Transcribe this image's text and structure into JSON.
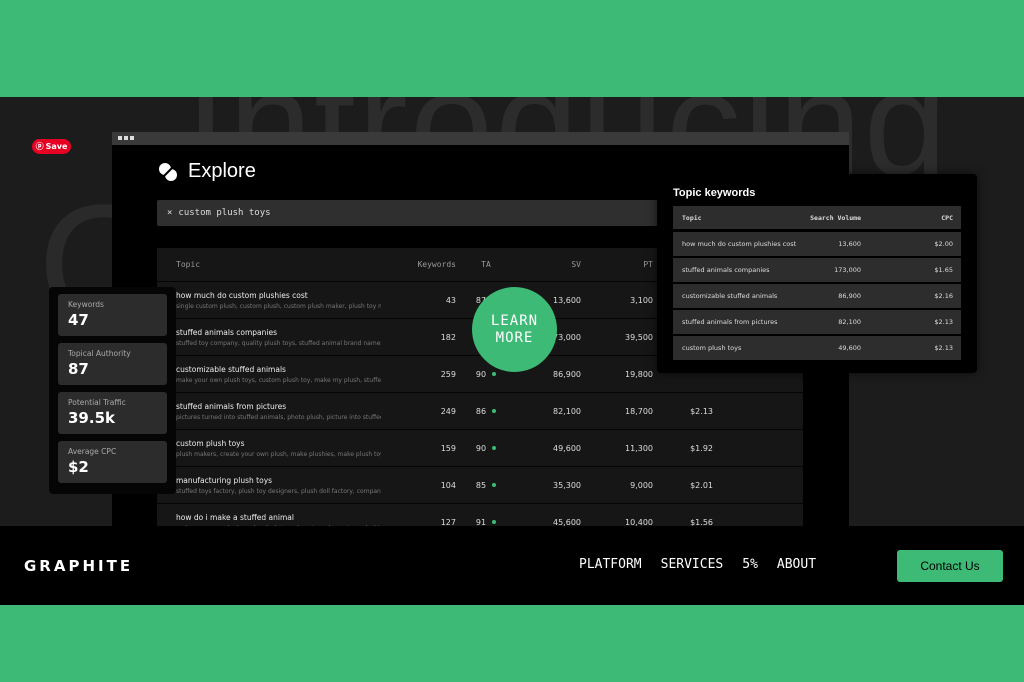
{
  "background": {
    "headline": "Introducing",
    "partial_letter": "O"
  },
  "pinterest": {
    "save_label": "Save"
  },
  "app": {
    "title": "Explore",
    "search": {
      "query": "custom plush toys",
      "clear_icon": "×"
    },
    "table": {
      "headers": [
        "Topic",
        "Keywords",
        "TA",
        "SV",
        "PT"
      ],
      "rows": [
        {
          "topic": "how much do custom plushies cost",
          "sub": "single custom plush, custom plush, custom plush maker, plush toy maker",
          "keywords": "43",
          "ta": "87",
          "sv": "13,600",
          "pt": "3,100",
          "cpc": ""
        },
        {
          "topic": "stuffed animals companies",
          "sub": "stuffed toy company, quality plush toys, stuffed animal brand names, wh...",
          "keywords": "182",
          "ta": "",
          "sv": "173,000",
          "pt": "39,500",
          "cpc": ""
        },
        {
          "topic": "customizable stuffed animals",
          "sub": "make your own plush toys, custom plush toy, make my plush, stuffed ani...",
          "keywords": "259",
          "ta": "90",
          "sv": "86,900",
          "pt": "19,800",
          "cpc": ""
        },
        {
          "topic": "stuffed animals from pictures",
          "sub": "pictures turned into stuffed animals, photo plush, picture into stuffed ani...",
          "keywords": "249",
          "ta": "86",
          "sv": "82,100",
          "pt": "18,700",
          "cpc": "$2.13"
        },
        {
          "topic": "custom plush toys",
          "sub": "plush makers, create your own plush, make plushies, make plush toys",
          "keywords": "159",
          "ta": "90",
          "sv": "49,600",
          "pt": "11,300",
          "cpc": "$1.92"
        },
        {
          "topic": "manufacturing plush toys",
          "sub": "stuffed toys factory, plush toy designers, plush doll factory, companies th...",
          "keywords": "104",
          "ta": "85",
          "sv": "35,300",
          "pt": "9,000",
          "cpc": "$2.01"
        },
        {
          "topic": "how do i make a stuffed animal",
          "sub": "make your own plush, make plush toys, how to make custom plushies, ho...",
          "keywords": "127",
          "ta": "91",
          "sv": "45,600",
          "pt": "10,400",
          "cpc": "$1.56"
        }
      ]
    }
  },
  "cta": {
    "line1": "LEARN",
    "line2": "MORE"
  },
  "stats": [
    {
      "label": "Keywords",
      "value": "47"
    },
    {
      "label": "Topical Authority",
      "value": "87"
    },
    {
      "label": "Potential Traffic",
      "value": "39.5k"
    },
    {
      "label": "Average CPC",
      "value": "$2"
    }
  ],
  "topic_keywords": {
    "title": "Topic keywords",
    "headers": [
      "Topic",
      "Search Volume",
      "CPC"
    ],
    "rows": [
      {
        "topic": "how much do custom plushies cost",
        "sv": "13,600",
        "cpc": "$2.00"
      },
      {
        "topic": "stuffed animals companies",
        "sv": "173,000",
        "cpc": "$1.65"
      },
      {
        "topic": "customizable stuffed animals",
        "sv": "86,900",
        "cpc": "$2.16"
      },
      {
        "topic": "stuffed animals from pictures",
        "sv": "82,100",
        "cpc": "$2.13"
      },
      {
        "topic": "custom plush toys",
        "sv": "49,600",
        "cpc": "$2.13"
      }
    ]
  },
  "nav": {
    "brand": "GRAPHITE",
    "links": [
      "PLATFORM",
      "SERVICES",
      "5%",
      "ABOUT"
    ],
    "contact": "Contact Us"
  },
  "colors": {
    "accent": "#3dba76",
    "pinterest": "#e60023"
  }
}
